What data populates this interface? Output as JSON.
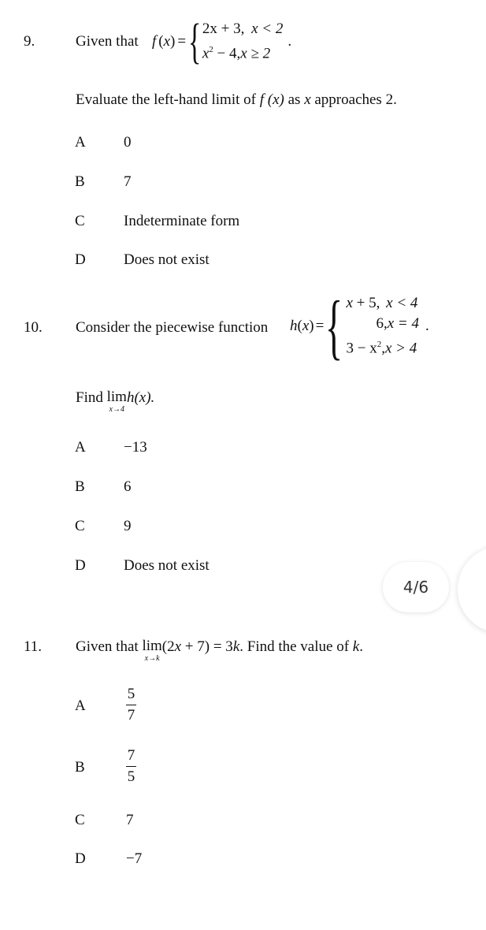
{
  "questions": [
    {
      "number": "9.",
      "stem_prefix": "Given that",
      "function_name": "f",
      "function_var": "(x)",
      "equals": "=",
      "cases": [
        "2x + 3,  x < 2",
        "x² − 4, x ≥ 2"
      ],
      "cases_parts": [
        {
          "expr": "2x + 3,",
          "cond": "x < 2"
        },
        {
          "expr_base": "x",
          "expr_sup": "2",
          "expr_rest": " − 4,",
          "cond": "x ≥ 2"
        }
      ],
      "trailing": ".",
      "prompt_parts": {
        "before": "Evaluate the left-hand limit of",
        "func": "f (x)",
        "middle": "as",
        "var": "x",
        "after": "approaches 2."
      },
      "options": [
        {
          "letter": "A",
          "value": "0"
        },
        {
          "letter": "B",
          "value": "7"
        },
        {
          "letter": "C",
          "value": "Indeterminate form"
        },
        {
          "letter": "D",
          "value": "Does not exist"
        }
      ]
    },
    {
      "number": "10.",
      "stem_prefix": "Consider the piecewise function",
      "function_name": "h",
      "function_var": "(x)",
      "equals": "=",
      "cases_parts": [
        {
          "expr": "x + 5,",
          "cond": "x < 4"
        },
        {
          "expr": "6,",
          "cond": "x = 4"
        },
        {
          "expr_base": "3 − x",
          "expr_sup": "2",
          "expr_rest": ",",
          "cond": "x > 4"
        }
      ],
      "trailing": ".",
      "prompt_parts": {
        "before": "Find",
        "lim": "lim",
        "lim_sub": "x→4",
        "expr": "h(x)."
      },
      "options": [
        {
          "letter": "A",
          "value": "−13"
        },
        {
          "letter": "B",
          "value": "6"
        },
        {
          "letter": "C",
          "value": "9"
        },
        {
          "letter": "D",
          "value": "Does not exist"
        }
      ]
    },
    {
      "number": "11.",
      "stem_prefix": "Given that",
      "lim": "lim",
      "lim_sub": "x→k",
      "lim_expr": "(2x + 7) = 3k.",
      "stem_suffix": "Find the value of",
      "var": "k",
      "end": ".",
      "options": [
        {
          "letter": "A",
          "numerator": "5",
          "denominator": "7"
        },
        {
          "letter": "B",
          "numerator": "7",
          "denominator": "5"
        },
        {
          "letter": "C",
          "value": "7"
        },
        {
          "letter": "D",
          "value": "−7"
        }
      ]
    }
  ],
  "viewer": {
    "page_indicator": "4/6",
    "current_page": 4,
    "total_pages": 6
  }
}
